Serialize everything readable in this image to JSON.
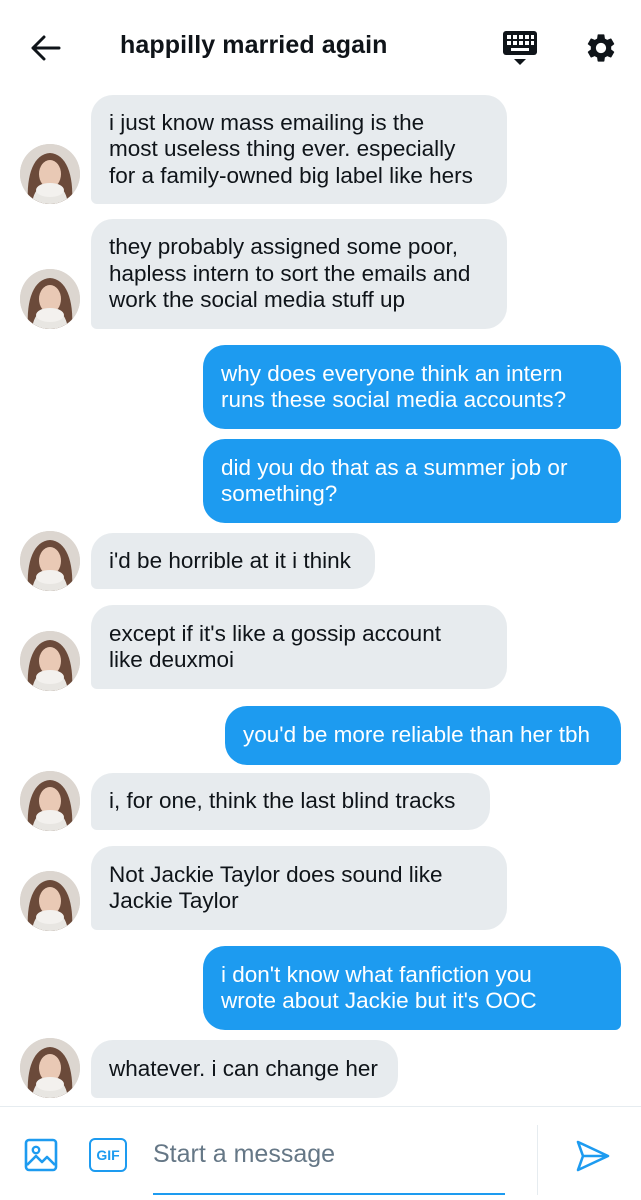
{
  "header": {
    "title": "happilly married again",
    "back_icon": "arrow-left-icon",
    "keyboard_icon": "keyboard-icon",
    "settings_icon": "gear-icon"
  },
  "messages": [
    {
      "from": "them",
      "text": "i just know mass emailing is the\nmost useless thing ever. especially\nfor a family-owned big label like hers"
    },
    {
      "from": "them",
      "text": "they probably assigned some poor,\nhapless intern to sort the emails and\nwork the social media stuff up"
    },
    {
      "from": "me",
      "text": "why does everyone think an intern\nruns these social media accounts?"
    },
    {
      "from": "me",
      "text": "did you do that as a summer job or\nsomething?"
    },
    {
      "from": "them",
      "text": "i'd be horrible at it i think"
    },
    {
      "from": "them",
      "text": "except if it's like a gossip account\nlike deuxmoi"
    },
    {
      "from": "me",
      "text": "you'd be more reliable than her tbh"
    },
    {
      "from": "them",
      "text": "i, for one, think the last blind tracks"
    },
    {
      "from": "them",
      "text": "Not Jackie Taylor does sound like\nJackie Taylor"
    },
    {
      "from": "me",
      "text": "i don't know what fanfiction you\nwrote about Jackie but it's OOC"
    },
    {
      "from": "them",
      "text": "whatever. i can change her"
    }
  ],
  "composer": {
    "placeholder": "Start a message",
    "gif_label": "GIF",
    "image_icon": "image-icon",
    "send_icon": "send-icon"
  },
  "colors": {
    "accent": "#1d9bf0",
    "incoming_bubble": "#e7ebee",
    "text": "#0f1419"
  }
}
